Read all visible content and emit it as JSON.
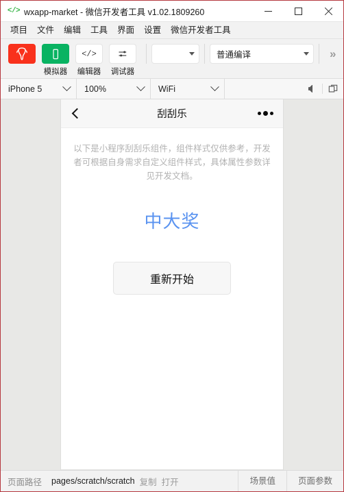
{
  "window": {
    "logo_icon": "code-brackets-icon",
    "title": "wxapp-market - 微信开发者工具 v1.02.1809260",
    "controls": {
      "minimize": "minimize-icon",
      "maximize": "maximize-icon",
      "close": "close-icon"
    }
  },
  "menubar": {
    "items": [
      {
        "label": "项目"
      },
      {
        "label": "文件"
      },
      {
        "label": "编辑"
      },
      {
        "label": "工具"
      },
      {
        "label": "界面"
      },
      {
        "label": "设置"
      },
      {
        "label": "微信开发者工具"
      }
    ]
  },
  "toolbar": {
    "buttons": [
      {
        "label": "",
        "icon": "stethoscope-icon",
        "color": "#f9311c"
      },
      {
        "label": "模拟器",
        "icon": "phone-icon",
        "color": "#09b362"
      },
      {
        "label": "编辑器",
        "icon": "code-icon",
        "color": "#ffffff"
      },
      {
        "label": "调试器",
        "icon": "sliders-icon",
        "color": "#ffffff"
      }
    ],
    "account_select": {
      "value": "",
      "caret": "caret-down-icon"
    },
    "compile_select": {
      "value": "普通编译",
      "caret": "caret-down-icon"
    },
    "overflow": "chevron-double-right-icon"
  },
  "devicebar": {
    "device": {
      "value": "iPhone 5",
      "caret": "chevron-down-icon"
    },
    "zoom": {
      "value": "100%",
      "caret": "chevron-down-icon"
    },
    "network": {
      "value": "WiFi",
      "caret": "chevron-down-icon"
    },
    "mute_icon": "speaker-mute-icon",
    "detach_icon": "detach-window-icon"
  },
  "simulator": {
    "nav": {
      "back_icon": "back-chevron-icon",
      "title": "刮刮乐",
      "menu_icon": "more-dots-icon"
    },
    "description": "以下是小程序刮刮乐组件，组件样式仅供参考，开发者可根据自身需求自定义组件样式，具体属性参数详见开发文档。",
    "prize_text": "中大奖",
    "prize_color": "#5a93f0",
    "restart_button": "重新开始"
  },
  "bottombar": {
    "path_label": "页面路径",
    "path_value": "pages/scratch/scratch",
    "copy_link": "复制",
    "open_link": "打开",
    "scene_value_tab": "场景值",
    "page_params_tab": "页面参数"
  }
}
